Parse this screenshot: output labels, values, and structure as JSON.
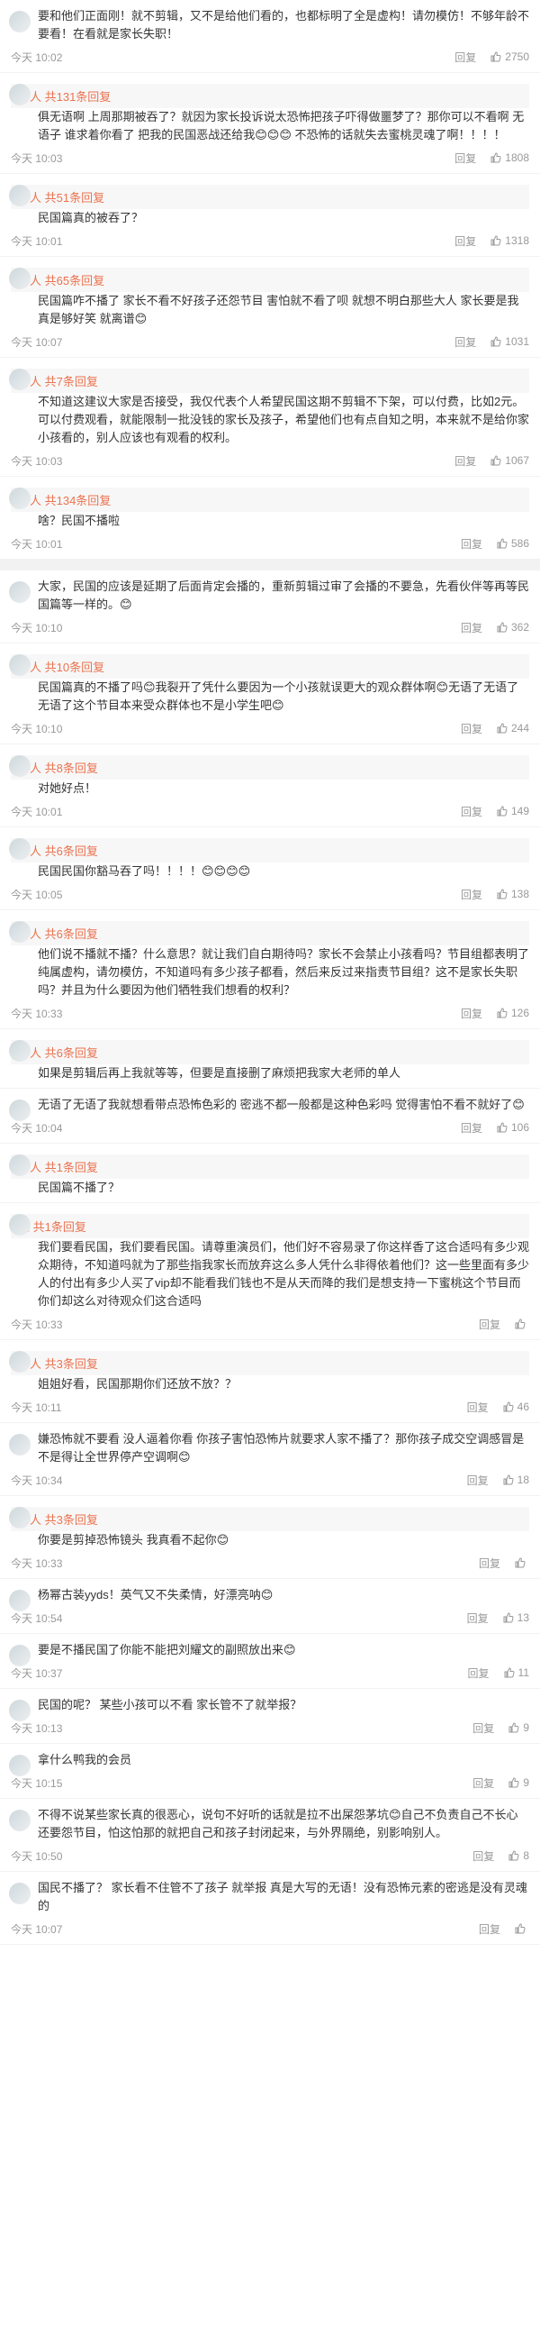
{
  "ui": {
    "reply_label": "回复",
    "thumb_icon": "thumbs-up-icon",
    "accent": "#eb7350",
    "badge_color": "#ff8200"
  },
  "comments": [
    {
      "text": "要和他们正面刚！就不剪辑，又不是给他们看的，也都标明了全是虚构！请勿模仿！不够年龄不要看！在看就是家长失职！",
      "time": "今天 10:02",
      "likes": "2750",
      "replies": "",
      "emojis": 0
    },
    {
      "text": "俱无语啊 上周那期被吞了？就因为家长投诉说太恐怖把孩子吓得做噩梦了？那你可以不看啊 无语子 谁求着你看了 把我的民国恶战还给我😊😊😊 不恐怖的话就失去蜜桃灵魂了啊！！！！",
      "time": "今天 10:03",
      "likes": "1808",
      "replies": "等人 共131条回复",
      "emojis": 3
    },
    {
      "text": "民国篇真的被吞了？",
      "time": "今天 10:01",
      "likes": "1318",
      "replies": "等人 共51条回复",
      "emojis": 0
    },
    {
      "text": "民国篇咋不播了 家长不看不好孩子还怨节目 害怕就不看了呗 就想不明白那些大人 家长要是我真是够好笑 就离谱😊",
      "time": "今天 10:07",
      "likes": "1031",
      "replies": "等人 共65条回复",
      "emojis": 1
    },
    {
      "text": "不知道这建议大家是否接受，我仅代表个人希望民国这期不剪辑不下架，可以付费，比如2元。可以付费观看，就能限制一批没钱的家长及孩子，希望他们也有点自知之明，本来就不是给你家小孩看的，别人应该也有观看的权利。",
      "time": "今天 10:03",
      "likes": "1067",
      "replies": "等人 共7条回复",
      "emojis": 0
    },
    {
      "text": "啥？民国不播啦",
      "time": "今天 10:01",
      "likes": "586",
      "replies": "等人 共134条回复",
      "emojis": 0
    },
    {
      "text": "大家，民国的应该是延期了后面肯定会播的，重新剪辑过审了会播的不要急，先看伙伴等再等民国篇等一样的。😊",
      "time": "今天 10:10",
      "likes": "362",
      "replies": "",
      "emojis": 1
    },
    {
      "text": "民国篇真的不播了吗😊我裂开了凭什么要因为一个小孩就误更大的观众群体啊😊无语了无语了无语了这个节目本来受众群体也不是小学生吧😊",
      "time": "今天 10:10",
      "likes": "244",
      "replies": "等人 共10条回复",
      "emojis": 3
    },
    {
      "text": "对她好点！",
      "time": "今天 10:01",
      "likes": "149",
      "replies": "等人 共8条回复",
      "emojis": 0
    },
    {
      "text": "民国民国你豁马吞了吗！！！！😊😊😊😊",
      "time": "今天 10:05",
      "likes": "138",
      "replies": "等人 共6条回复",
      "emojis": 4
    },
    {
      "text": "他们说不播就不播？什么意思？就让我们自白期待吗？家长不会禁止小孩看吗？节目组都表明了纯属虚构，请勿模仿，不知道吗有多少孩子都看，然后来反过来指责节目组？这不是家长失职吗？并且为什么要因为他们牺牲我们想看的权利？",
      "time": "今天 10:33",
      "likes": "126",
      "replies": "等人 共6条回复",
      "emojis": 0
    },
    {
      "text": "如果是剪辑后再上我就等等，但要是直接删了麻烦把我家大老师的单人",
      "time": "",
      "likes": "",
      "replies": "等人 共6条回复",
      "emojis": 0
    },
    {
      "text": "无语了无语了我就想看带点恐怖色彩的 密逃不都一般都是这种色彩吗 觉得害怕不看不就好了😊",
      "time": "今天 10:04",
      "likes": "106",
      "replies": "",
      "emojis": 1
    },
    {
      "text": "民国篇不播了？",
      "time": "",
      "likes": "",
      "replies": "等人 共1条回复",
      "emojis": 0
    },
    {
      "text": "我们要看民国，我们要看民国。请尊重演员们，他们好不容易录了你这样香了这合适吗有多少观众期待，不知道吗就为了那些指我家长而放弃这么多人凭什么非得依着他们？这一些里面有多少人的付出有多少人买了vip却不能看我们钱也不是从天而降的我们是想支持一下蜜桃这个节目而你们却这么对待观众们这合适吗",
      "time": "今天 10:33",
      "likes": "",
      "replies": "人 共1条回复",
      "emojis": 0
    },
    {
      "text": "姐姐好看，民国那期你们还放不放？？",
      "time": "今天 10:11",
      "likes": "46",
      "replies": "等人 共3条回复",
      "emojis": 0
    },
    {
      "text": "嫌恐怖就不要看 没人逼着你看 你孩子害怕恐怖片就要求人家不播了？那你孩子成交空调感冒是不是得让全世界停产空调啊😊",
      "time": "今天 10:34",
      "likes": "18",
      "replies": "",
      "emojis": 1
    },
    {
      "text": "你要是剪掉恐怖镜头 我真看不起你😊",
      "time": "今天 10:33",
      "likes": "",
      "replies": "等人 共3条回复",
      "emojis": 1
    },
    {
      "text": "杨幂古装yyds！英气又不失柔情，好漂亮呐😊",
      "time": "今天 10:54",
      "likes": "13",
      "replies": "",
      "emojis": 1
    },
    {
      "text": "要是不播民国了你能不能把刘耀文的副照放出来😊",
      "time": "今天 10:37",
      "likes": "11",
      "replies": "",
      "emojis": 1
    },
    {
      "text": "民国的呢？ 某些小孩可以不看 家长管不了就举报？",
      "time": "今天 10:13",
      "likes": "9",
      "replies": "",
      "emojis": 0
    },
    {
      "text": "拿什么鸭我的会员",
      "time": "今天 10:15",
      "likes": "9",
      "replies": "",
      "emojis": 0
    },
    {
      "text": "不得不说某些家长真的很恶心，说句不好听的话就是拉不出屎怨茅坑😊自己不负责自己不长心还要怨节目，怕这怕那的就把自己和孩子封闭起来，与外界隔绝，别影响别人。",
      "time": "今天 10:50",
      "likes": "8",
      "replies": "",
      "emojis": 1
    },
    {
      "text": "国民不播了？ 家长看不住管不了孩子 就举报 真是大写的无语！没有恐怖元素的密逃是没有灵魂的",
      "time": "今天 10:07",
      "likes": "",
      "replies": "",
      "emojis": 0
    }
  ]
}
